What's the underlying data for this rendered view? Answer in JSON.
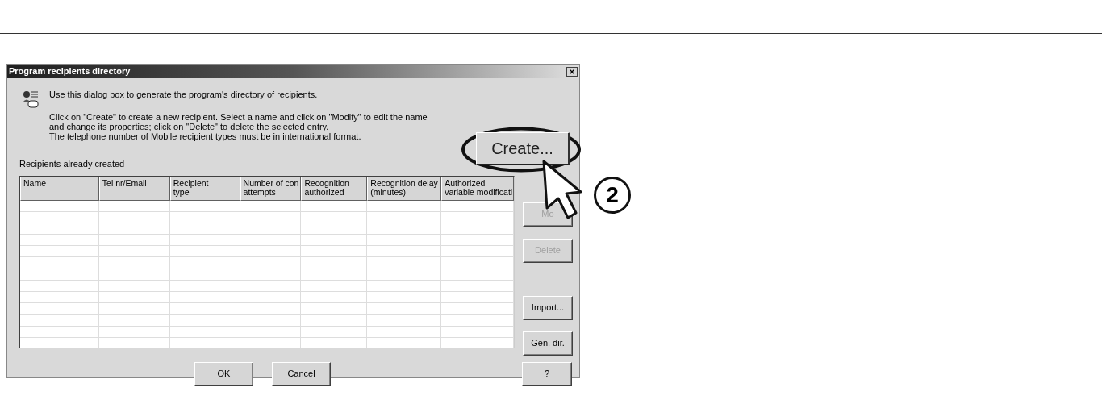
{
  "window": {
    "title": "Program recipients directory"
  },
  "intro": "Use this dialog box to generate the program's directory of recipients.",
  "instructions": [
    "Click on \"Create\" to create a new recipient. Select a name and click on \"Modify\" to edit the name",
    "and change its properties; click on \"Delete\" to delete the selected entry.",
    "The telephone number of Mobile recipient types must be in international format."
  ],
  "table": {
    "label": "Recipients already created",
    "columns": [
      [
        "Name"
      ],
      [
        "Tel nr/Email"
      ],
      [
        "Recipient",
        "type"
      ],
      [
        "Number of con",
        "attempts"
      ],
      [
        "Recognition",
        "authorized"
      ],
      [
        "Recognition delay",
        "(minutes)"
      ],
      [
        "Authorized",
        "variable modificati"
      ]
    ]
  },
  "side_buttons": [
    {
      "label": "Mo",
      "disabled": true
    },
    {
      "label": "Delete",
      "disabled": true
    },
    {
      "label": "Import...",
      "disabled": false
    },
    {
      "label": "Gen. dir.",
      "disabled": false
    }
  ],
  "bottom_buttons": [
    {
      "label": "OK"
    },
    {
      "label": "Cancel"
    }
  ],
  "help_button": "?",
  "callout": {
    "button": "Create...",
    "step": "2"
  }
}
